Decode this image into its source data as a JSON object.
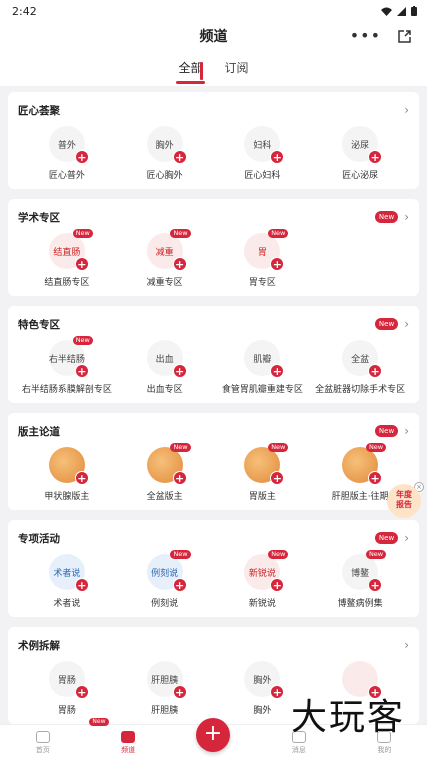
{
  "status": {
    "time": "2:42"
  },
  "header": {
    "title": "频道",
    "more": "•••"
  },
  "tabs": [
    {
      "label": "全部"
    },
    {
      "label": "订阅"
    }
  ],
  "sections": [
    {
      "title": "匠心荟聚",
      "new": false,
      "items": [
        {
          "label": "匠心普外",
          "icon": "普外",
          "style": "",
          "new": false
        },
        {
          "label": "匠心胸外",
          "icon": "胸外",
          "style": "",
          "new": false
        },
        {
          "label": "匠心妇科",
          "icon": "妇科",
          "style": "",
          "new": false
        },
        {
          "label": "匠心泌尿",
          "icon": "泌尿",
          "style": "",
          "new": false
        }
      ]
    },
    {
      "title": "学术专区",
      "new": true,
      "items": [
        {
          "label": "结直肠专区",
          "icon": "结直肠",
          "style": "pinkish",
          "new": true
        },
        {
          "label": "减重专区",
          "icon": "减重",
          "style": "pinkish",
          "new": true
        },
        {
          "label": "胃专区",
          "icon": "胃",
          "style": "pinkish",
          "new": true
        }
      ]
    },
    {
      "title": "特色专区",
      "new": true,
      "items": [
        {
          "label": "右半结肠系膜解剖专区",
          "icon": "右半结肠",
          "style": "",
          "new": true
        },
        {
          "label": "出血专区",
          "icon": "出血",
          "style": "",
          "new": false
        },
        {
          "label": "食管胃肌瓣重建专区",
          "icon": "肌瓣",
          "style": "",
          "new": false
        },
        {
          "label": "全盆脏器切除手术专区",
          "icon": "全盆",
          "style": "",
          "new": false
        }
      ]
    },
    {
      "title": "版主论道",
      "new": true,
      "items": [
        {
          "label": "甲状腺版主",
          "icon": "",
          "style": "orange",
          "new": false
        },
        {
          "label": "全盆版主",
          "icon": "",
          "style": "orange",
          "new": true
        },
        {
          "label": "胃版主",
          "icon": "",
          "style": "orange",
          "new": true
        },
        {
          "label": "肝胆版主·往期",
          "icon": "",
          "style": "orange",
          "new": true
        }
      ]
    },
    {
      "title": "专项活动",
      "new": true,
      "items": [
        {
          "label": "术者说",
          "icon": "术者说",
          "style": "blue",
          "new": false
        },
        {
          "label": "例刻说",
          "icon": "例刻说",
          "style": "blue",
          "new": true
        },
        {
          "label": "新锐说",
          "icon": "新锐说",
          "style": "pinkish",
          "new": true
        },
        {
          "label": "博鳌病例集",
          "icon": "博鳌",
          "style": "",
          "new": true
        }
      ]
    },
    {
      "title": "术例拆解",
      "new": false,
      "items": [
        {
          "label": "胃肠",
          "icon": "胃肠",
          "style": "",
          "new": false
        },
        {
          "label": "肝胆胰",
          "icon": "肝胆胰",
          "style": "",
          "new": false
        },
        {
          "label": "胸外",
          "icon": "胸外",
          "style": "",
          "new": false
        },
        {
          "label": "",
          "icon": "",
          "style": "pinkish",
          "new": false
        }
      ]
    }
  ],
  "new_tag": "New",
  "float_badge": {
    "line1": "年度",
    "line2": "报告"
  },
  "nav": [
    {
      "label": "首页"
    },
    {
      "label": "频道"
    },
    {
      "label": "+"
    },
    {
      "label": "消息"
    },
    {
      "label": "我的"
    }
  ],
  "watermark": "大玩客"
}
